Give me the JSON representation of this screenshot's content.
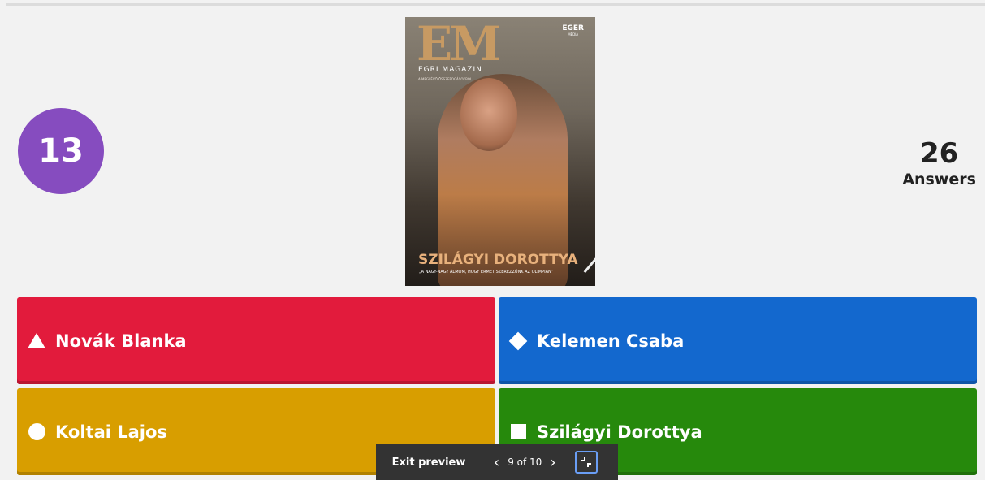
{
  "timer": {
    "value": "13"
  },
  "answers": {
    "count": "26",
    "label": "Answers"
  },
  "cover": {
    "logo": "EM",
    "magazine_name": "EGRI MAGAZIN",
    "small_text": "A MEGLÉVŐ ÖSSZEFOGÁSOKBÓL",
    "publisher": "EGER",
    "publisher_sub": "MÉDIA",
    "headline": "SZILÁGYI DOROTTYA",
    "quote": "„A NAGY-NAGY ÁLMOM, HOGY ÉRMET SZEREZZÜNK AZ OLIMPIÁN”"
  },
  "choices": [
    {
      "label": "Novák Blanka",
      "shape": "triangle-icon",
      "color": "#e21b3c"
    },
    {
      "label": "Kelemen Csaba",
      "shape": "diamond-icon",
      "color": "#1368ce"
    },
    {
      "label": "Koltai Lajos",
      "shape": "circle-icon",
      "color": "#d89e00"
    },
    {
      "label": "Szilágyi Dorottya",
      "shape": "square-icon",
      "color": "#26890c"
    }
  ],
  "preview_bar": {
    "exit_label": "Exit preview",
    "page_indicator": "9 of 10"
  }
}
